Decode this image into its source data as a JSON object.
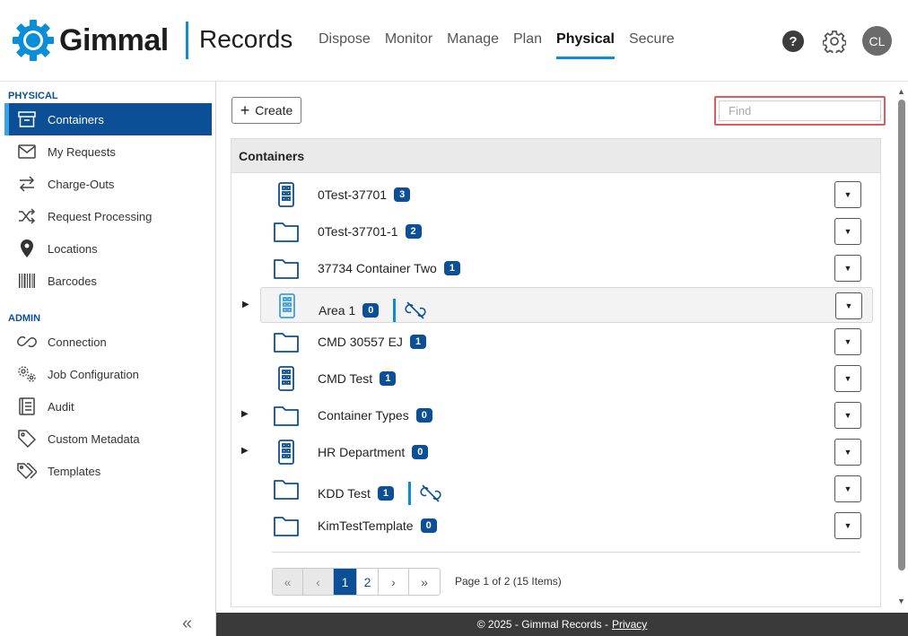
{
  "header": {
    "logo_text": "Gimmal",
    "product": "Records",
    "nav": [
      "Dispose",
      "Monitor",
      "Manage",
      "Plan",
      "Physical",
      "Secure"
    ],
    "active_nav": "Physical",
    "help": "?",
    "avatar": "CL",
    "accent_color": "#0a8ed9"
  },
  "sidebar": {
    "physical_label": "PHYSICAL",
    "physical_items": [
      {
        "label": "Containers",
        "icon": "archive-box-icon",
        "active": true
      },
      {
        "label": "My Requests",
        "icon": "envelope-icon"
      },
      {
        "label": "Charge-Outs",
        "icon": "swap-arrows-icon"
      },
      {
        "label": "Request Processing",
        "icon": "shuffle-icon"
      },
      {
        "label": "Locations",
        "icon": "map-pin-icon"
      },
      {
        "label": "Barcodes",
        "icon": "barcode-icon"
      }
    ],
    "admin_label": "ADMIN",
    "admin_items": [
      {
        "label": "Connection",
        "icon": "link-icon"
      },
      {
        "label": "Job Configuration",
        "icon": "gears-icon"
      },
      {
        "label": "Audit",
        "icon": "ledger-icon"
      },
      {
        "label": "Custom Metadata",
        "icon": "tag-icon"
      },
      {
        "label": "Templates",
        "icon": "tags-icon"
      }
    ],
    "active_color": "#0b4f96"
  },
  "toolbar": {
    "create_label": "Create",
    "find_placeholder": "Find"
  },
  "panel": {
    "title": "Containers",
    "rows": [
      {
        "name": "0Test-37701",
        "count": "3",
        "icon": "building-icon"
      },
      {
        "name": "0Test-37701-1",
        "count": "2",
        "icon": "folder-icon"
      },
      {
        "name": "37734 Container Two",
        "count": "1",
        "icon": "folder-icon"
      },
      {
        "name": "Area 1",
        "count": "0",
        "icon": "building-icon",
        "expandable": true,
        "selected": true,
        "unlinked": true
      },
      {
        "name": "CMD 30557 EJ",
        "count": "1",
        "icon": "folder-icon"
      },
      {
        "name": "CMD Test",
        "count": "1",
        "icon": "building-icon"
      },
      {
        "name": "Container Types",
        "count": "0",
        "icon": "folder-icon",
        "expandable": true
      },
      {
        "name": "HR Department",
        "count": "0",
        "icon": "building-icon",
        "expandable": true
      },
      {
        "name": "KDD Test",
        "count": "1",
        "icon": "folder-icon",
        "unlinked": true
      },
      {
        "name": "KimTestTemplate",
        "count": "0",
        "icon": "folder-icon"
      }
    ]
  },
  "pagination": {
    "pages": [
      "1",
      "2"
    ],
    "current": "1",
    "info": "Page 1 of 2 (15 Items)"
  },
  "footer": {
    "text": "© 2025 - Gimmal Records -",
    "link": "Privacy"
  }
}
